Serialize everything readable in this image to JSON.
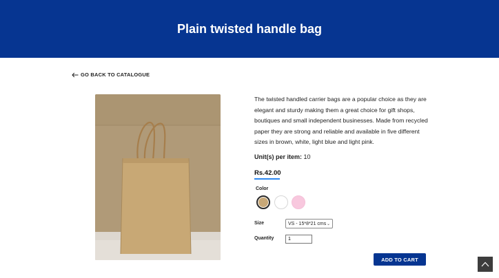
{
  "header": {
    "title": "Plain twisted handle bag"
  },
  "nav": {
    "back_label": "GO BACK TO CATALOGUE"
  },
  "product": {
    "description": "The twisted handled carrier bags are a popular choice as they are elegant and sturdy making them a great choice for gift shops, boutiques and small independent businesses. Made from recycled paper they are strong and reliable and available in five different sizes in brown, white, light blue and light pink.",
    "unit_label": "Unit(s) per item:",
    "unit_value": "10",
    "price": "Rs.42.00",
    "color_label": "Color",
    "colors": [
      {
        "name": "brown",
        "hex": "#c8a877",
        "selected": true
      },
      {
        "name": "white",
        "hex": "#ffffff",
        "selected": false
      },
      {
        "name": "light pink",
        "hex": "#f8c8de",
        "selected": false
      }
    ],
    "size_label": "Size",
    "size_selected": "VS - 15*8*21 cms",
    "quantity_label": "Quantity",
    "quantity_value": "1",
    "add_to_cart_label": "ADD TO CART"
  },
  "theme": {
    "brand": "#063591",
    "accent": "#2a86f0"
  },
  "icons": {
    "back": "arrow-left-icon",
    "scroll_top": "chevron-up-icon",
    "select": "chevron-down-icon"
  }
}
